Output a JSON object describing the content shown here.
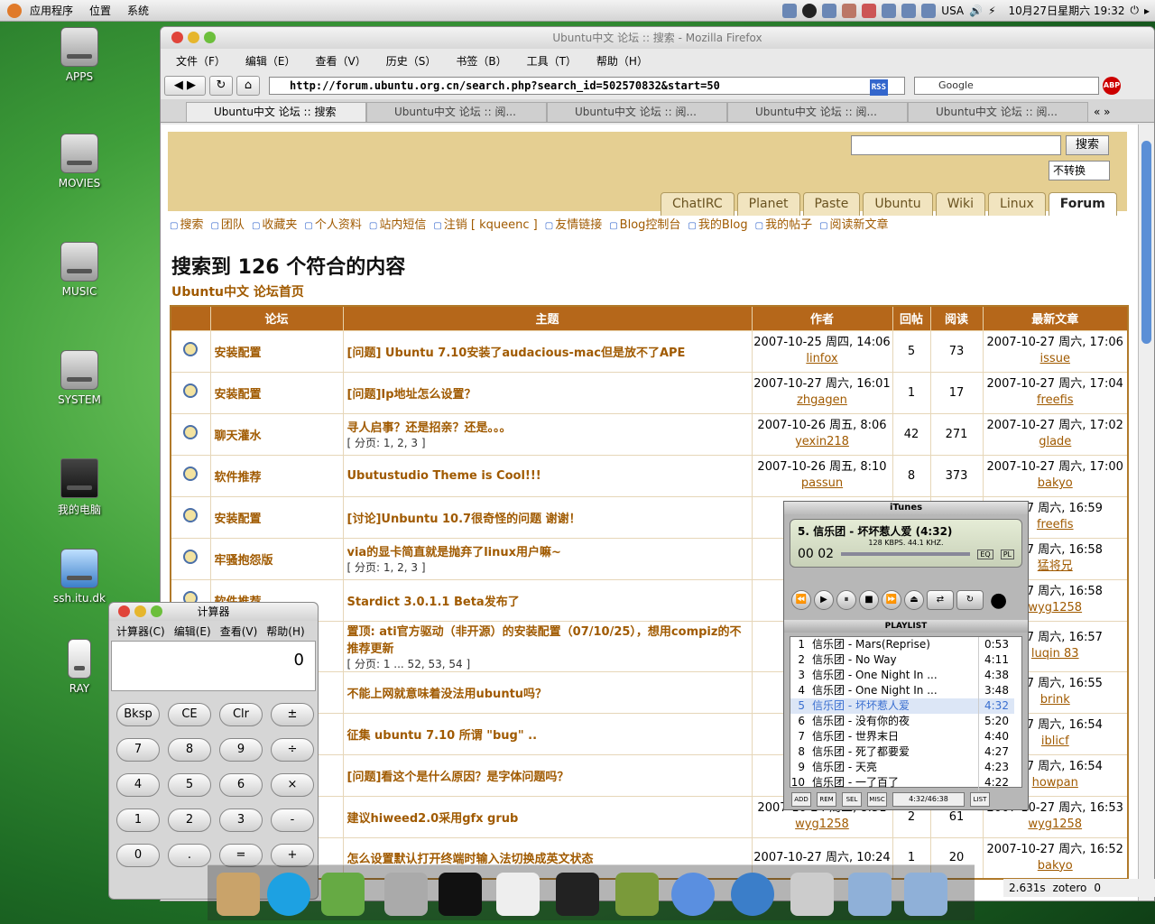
{
  "top_panel": {
    "menus": [
      "应用程序",
      "位置",
      "系统"
    ],
    "locale": "USA",
    "datetime": "10月27日星期六 19:32"
  },
  "desktop_icons": [
    "APPS",
    "MOVIES",
    "MUSIC",
    "SYSTEM",
    "我的电脑",
    "ssh.itu.dk",
    "RAY"
  ],
  "firefox": {
    "title": "Ubuntu中文 论坛 :: 搜索 - Mozilla Firefox",
    "menus": [
      "文件（F）",
      "编辑（E）",
      "查看（V）",
      "历史（S）",
      "书签（B）",
      "工具（T）",
      "帮助（H）"
    ],
    "url": "http://forum.ubuntu.org.cn/search.php?search_id=502570832&start=50",
    "rss": "RSS",
    "search_placeholder": "Google",
    "tabs": [
      "Ubuntu中文 论坛 :: 搜索",
      "Ubuntu中文 论坛 :: 阅...",
      "Ubuntu中文 论坛 :: 阅...",
      "Ubuntu中文 论坛 :: 阅...",
      "Ubuntu中文 论坛 :: 阅..."
    ]
  },
  "page": {
    "search_button": "搜索",
    "convert_select": "不转换",
    "site_tabs": [
      "ChatIRC",
      "Planet",
      "Paste",
      "Ubuntu",
      "Wiki",
      "Linux",
      "Forum"
    ],
    "nav_links": [
      "搜索",
      "团队",
      "收藏夹",
      "个人资料",
      "站内短信",
      "注销 [ kqueenc ]",
      "友情链接",
      "Blog控制台",
      "我的Blog",
      "我的帖子",
      "阅读新文章"
    ],
    "title": "搜索到 126 个符合的内容",
    "forum_home": "Ubuntu中文 论坛首页",
    "table_headers": [
      "论坛",
      "主题",
      "作者",
      "回帖",
      "阅读",
      "最新文章"
    ],
    "rows": [
      {
        "forum": "安装配置",
        "topic": "[问题] Ubuntu 7.10安装了audacious-mac但是放不了APE",
        "pages": "",
        "date": "2007-10-25 周四, 14:06",
        "author": "linfox",
        "replies": "5",
        "views": "73",
        "last_date": "2007-10-27 周六, 17:06",
        "last_user": "issue"
      },
      {
        "forum": "安装配置",
        "topic": "[问题]Ip地址怎么设置？",
        "pages": "",
        "date": "2007-10-27 周六, 16:01",
        "author": "zhgagen",
        "replies": "1",
        "views": "17",
        "last_date": "2007-10-27 周六, 17:04",
        "last_user": "freefis"
      },
      {
        "forum": "聊天灌水",
        "topic": "寻人启事？还是招亲？还是。。。",
        "pages": "[ 分页: 1, 2, 3 ]",
        "date": "2007-10-26 周五, 8:06",
        "author": "yexin218",
        "replies": "42",
        "views": "271",
        "last_date": "2007-10-27 周六, 17:02",
        "last_user": "glade"
      },
      {
        "forum": "软件推荐",
        "topic": "Ubutustudio Theme is Cool!!!",
        "pages": "",
        "date": "2007-10-26 周五, 8:10",
        "author": "passun",
        "replies": "8",
        "views": "373",
        "last_date": "2007-10-27 周六, 17:00",
        "last_user": "bakyo"
      },
      {
        "forum": "安装配置",
        "topic": "[讨论]Unbuntu 10.7很奇怪的问题 谢谢！",
        "pages": "",
        "date": "2007",
        "author": "",
        "replies": "",
        "views": "",
        "last_date": "0-27 周六, 16:59",
        "last_user": "freefis"
      },
      {
        "forum": "牢骚抱怨版",
        "topic": "via的显卡简直就是抛弃了linux用户嘛~",
        "pages": "[ 分页: 1, 2, 3 ]",
        "date": "2007",
        "author": "",
        "replies": "",
        "views": "",
        "last_date": "0-27 周六, 16:58",
        "last_user": "猛将兄"
      },
      {
        "forum": "软件推荐",
        "topic": "Stardict 3.0.1.1 Beta发布了",
        "pages": "",
        "date": "2007",
        "author": "",
        "replies": "",
        "views": "",
        "last_date": "0-27 周六, 16:58",
        "last_user": "wyg1258"
      },
      {
        "forum": "",
        "topic": "置顶: ati官方驱动（非开源）的安装配置（07/10/25），想用compiz的不推荐更新",
        "pages": "[ 分页: 1 ... 52, 53, 54 ]",
        "date": "2006",
        "author": "",
        "replies": "",
        "views": "",
        "last_date": "0-27 周六, 16:57",
        "last_user": "luqin 83"
      },
      {
        "forum": "",
        "topic": "不能上网就意味着没法用ubuntu吗？",
        "pages": "",
        "date": "2007",
        "author": "",
        "replies": "",
        "views": "",
        "last_date": "0-27 周六, 16:55",
        "last_user": "brink"
      },
      {
        "forum": "报",
        "topic": "征集 ubuntu 7.10 所谓 \"bug\" ..",
        "pages": "",
        "date": "2007",
        "author": "",
        "replies": "",
        "views": "",
        "last_date": "0-27 周六, 16:54",
        "last_user": "iblicf"
      },
      {
        "forum": "",
        "topic": "[问题]看这个是什么原因？是字体问题吗？",
        "pages": "",
        "date": "2006",
        "author": "",
        "replies": "",
        "views": "",
        "last_date": "0-27 周六, 16:54",
        "last_user": "howpan"
      },
      {
        "forum": "",
        "topic": "建议hiweed2.0采用gfx grub",
        "pages": "",
        "date": "2007-10-24 周三, 8:51",
        "author": "wyg1258",
        "replies": "2",
        "views": "61",
        "last_date": "2007-10-27 周六, 16:53",
        "last_user": "wyg1258"
      },
      {
        "forum": "",
        "topic": "怎么设置默认打开终端时输入法切换成英文状态",
        "pages": "",
        "date": "2007-10-27 周六, 10:24",
        "author": "",
        "replies": "1",
        "views": "20",
        "last_date": "2007-10-27 周六, 16:52",
        "last_user": "bakyo"
      }
    ]
  },
  "calculator": {
    "title": "计算器",
    "menus": [
      "计算器(C)",
      "编辑(E)",
      "查看(V)",
      "帮助(H)"
    ],
    "display": "0",
    "buttons": [
      "Bksp",
      "CE",
      "Clr",
      "±",
      "7",
      "8",
      "9",
      "÷",
      "4",
      "5",
      "6",
      "×",
      "1",
      "2",
      "3",
      "-",
      "0",
      ".",
      "=",
      "+"
    ]
  },
  "itunes": {
    "title": "iTunes",
    "now_playing": "5. 信乐团 - 坏坏惹人爱 (4:32)",
    "bitrate": "128 KBPS. 44.1 KHZ.",
    "time": "00 02",
    "eq": "EQ",
    "pl": "PL",
    "playlist_title": "PLAYLIST",
    "position": "4:32/46:38",
    "elapsed": "00:02",
    "playlist_buttons": [
      "ADD",
      "REM",
      "SEL",
      "MISC",
      "LIST"
    ],
    "tracks": [
      [
        "1",
        "信乐团 - Mars(Reprise)",
        "0:53"
      ],
      [
        "2",
        "信乐团 - No Way",
        "4:11"
      ],
      [
        "3",
        "信乐团 - One Night In ...",
        "4:38"
      ],
      [
        "4",
        "信乐团 - One Night In ...",
        "3:48"
      ],
      [
        "5",
        "信乐团 - 坏坏惹人爱",
        "4:32"
      ],
      [
        "6",
        "信乐团 - 没有你的夜",
        "5:20"
      ],
      [
        "7",
        "信乐团 - 世界末日",
        "4:40"
      ],
      [
        "8",
        "信乐团 - 死了都要爱",
        "4:27"
      ],
      [
        "9",
        "信乐团 - 天亮",
        "4:23"
      ],
      [
        "10",
        "信乐团 - 一了百了",
        "4:22"
      ]
    ],
    "selected_track": "5"
  },
  "zotero": {
    "timer": "2.631s",
    "label": "zotero",
    "count": "0"
  }
}
